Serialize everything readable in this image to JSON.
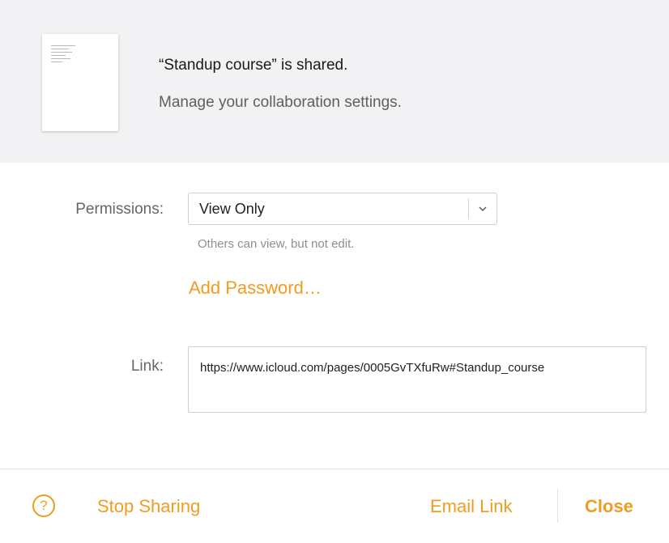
{
  "header": {
    "title": "“Standup course” is shared.",
    "subtitle": "Manage your collaboration settings."
  },
  "permissions": {
    "label": "Permissions:",
    "selected": "View Only",
    "hint": "Others can view, but not edit."
  },
  "add_password_label": "Add Password…",
  "link": {
    "label": "Link:",
    "url": "https://www.icloud.com/pages/0005GvTXfuRw#Standup_course"
  },
  "footer": {
    "help_glyph": "?",
    "stop_sharing_label": "Stop Sharing",
    "email_link_label": "Email Link",
    "close_label": "Close"
  },
  "colors": {
    "accent": "#f29c1f",
    "header_bg": "#f2f2f4",
    "label_gray": "#666666"
  },
  "icons": [
    "document-thumbnail",
    "chevron-down-icon",
    "help-icon"
  ]
}
